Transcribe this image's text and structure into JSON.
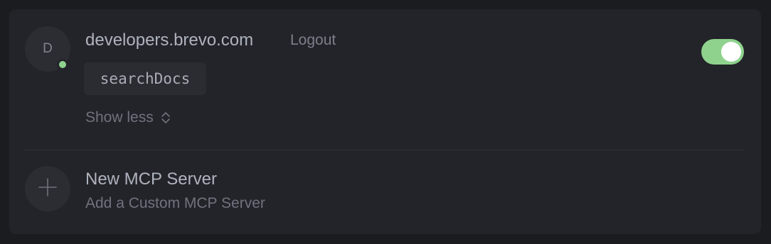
{
  "server": {
    "avatar_initial": "D",
    "name": "developers.brevo.com",
    "logout_label": "Logout",
    "tools": [
      "searchDocs"
    ],
    "show_less_label": "Show less",
    "enabled": true,
    "status_color": "#8fd28e"
  },
  "new_server": {
    "title": "New MCP Server",
    "subtitle": "Add a Custom MCP Server",
    "icon": "plus-icon"
  },
  "colors": {
    "accent": "#8fd28e",
    "background": "#1b1c20",
    "panel": "#232429"
  }
}
